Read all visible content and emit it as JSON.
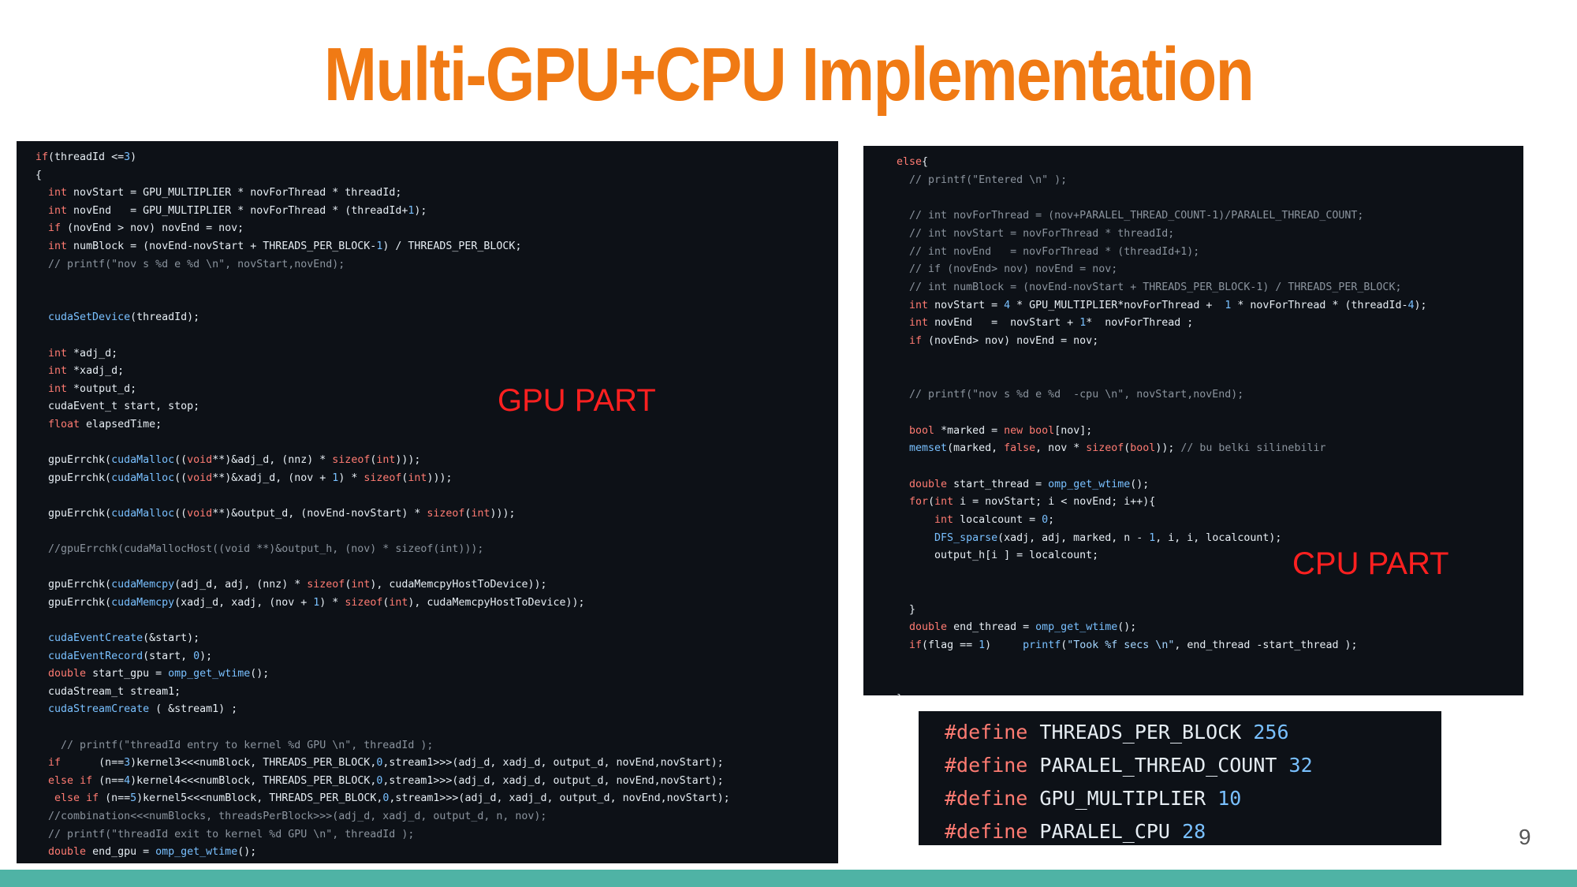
{
  "slide": {
    "title": "Multi-GPU+CPU Implementation",
    "page_number": "9"
  },
  "labels": {
    "gpu_part": "GPU PART",
    "cpu_part": "CPU PART"
  },
  "colors": {
    "title": "#f07a14",
    "label": "#ff2020",
    "code_background": "#0d1117",
    "keyword": "#ff7b72",
    "function": "#79c0ff",
    "comment": "#8b949e",
    "bottom_bar": "#4fb3a5"
  },
  "gpu_code": [
    "if(threadId <=3)",
    "{",
    "  int novStart = GPU_MULTIPLIER * novForThread * threadId;",
    "  int novEnd   = GPU_MULTIPLIER * novForThread * (threadId+1);",
    "  if (novEnd > nov) novEnd = nov;",
    "  int numBlock = (novEnd-novStart + THREADS_PER_BLOCK-1) / THREADS_PER_BLOCK;",
    "  // printf(\"nov s %d e %d \\n\", novStart,novEnd);",
    "",
    "",
    "  cudaSetDevice(threadId);",
    "",
    "  int *adj_d;",
    "  int *xadj_d;",
    "  int *output_d;",
    "  cudaEvent_t start, stop;",
    "  float elapsedTime;",
    "",
    "  gpuErrchk(cudaMalloc((void**)&adj_d, (nnz) * sizeof(int)));",
    "  gpuErrchk(cudaMalloc((void**)&xadj_d, (nov + 1) * sizeof(int)));",
    "",
    "  gpuErrchk(cudaMalloc((void**)&output_d, (novEnd-novStart) * sizeof(int)));",
    "",
    "  //gpuErrchk(cudaMallocHost((void **)&output_h, (nov) * sizeof(int)));",
    "",
    "  gpuErrchk(cudaMemcpy(adj_d, adj, (nnz) * sizeof(int), cudaMemcpyHostToDevice));",
    "  gpuErrchk(cudaMemcpy(xadj_d, xadj, (nov + 1) * sizeof(int), cudaMemcpyHostToDevice));",
    "",
    "  cudaEventCreate(&start);",
    "  cudaEventRecord(start, 0);",
    "  double start_gpu = omp_get_wtime();",
    "  cudaStream_t stream1;",
    "  cudaStreamCreate ( &stream1) ;",
    "",
    "    // printf(\"threadId entry to kernel %d GPU \\n\", threadId );",
    "  if      (n==3)kernel3<<<numBlock, THREADS_PER_BLOCK,0,stream1>>>(adj_d, xadj_d, output_d, novEnd,novStart);",
    "  else if (n==4)kernel4<<<numBlock, THREADS_PER_BLOCK,0,stream1>>>(adj_d, xadj_d, output_d, novEnd,novStart);",
    "   else if (n==5)kernel5<<<numBlock, THREADS_PER_BLOCK,0,stream1>>>(adj_d, xadj_d, output_d, novEnd,novStart);",
    "  //combination<<<numBlocks, threadsPerBlock>>>(adj_d, xadj_d, output_d, n, nov);",
    "  // printf(\"threadId exit to kernel %d GPU \\n\", threadId );",
    "  double end_gpu = omp_get_wtime();"
  ],
  "cpu_code": [
    "  else{",
    "    // printf(\"Entered \\n\" );",
    "",
    "    // int novForThread = (nov+PARALEL_THREAD_COUNT-1)/PARALEL_THREAD_COUNT;",
    "    // int novStart = novForThread * threadId;",
    "    // int novEnd   = novForThread * (threadId+1);",
    "    // if (novEnd> nov) novEnd = nov;",
    "    // int numBlock = (novEnd-novStart + THREADS_PER_BLOCK-1) / THREADS_PER_BLOCK;",
    "    int novStart = 4 * GPU_MULTIPLIER*novForThread +  1 * novForThread * (threadId-4);",
    "    int novEnd   =  novStart + 1*  novForThread ;",
    "    if (novEnd> nov) novEnd = nov;",
    "",
    "",
    "    // printf(\"nov s %d e %d  -cpu \\n\", novStart,novEnd);",
    "",
    "    bool *marked = new bool[nov];",
    "    memset(marked, false, nov * sizeof(bool)); // bu belki silinebilir",
    "",
    "    double start_thread = omp_get_wtime();",
    "    for(int i = novStart; i < novEnd; i++){",
    "        int localcount = 0;",
    "        DFS_sparse(xadj, adj, marked, n - 1, i, i, localcount);",
    "        output_h[i ] = localcount;",
    "",
    "",
    "    }",
    "    double end_thread = omp_get_wtime();",
    "    if(flag == 1)     printf(\"Took %f secs \\n\", end_thread -start_thread );",
    "",
    "",
    "  }"
  ],
  "defines": [
    {
      "keyword": "#define",
      "name": "THREADS_PER_BLOCK",
      "value": "256"
    },
    {
      "keyword": "#define",
      "name": "PARALEL_THREAD_COUNT",
      "value": "32"
    },
    {
      "keyword": "#define",
      "name": "GPU_MULTIPLIER",
      "value": "10"
    },
    {
      "keyword": "#define",
      "name": "PARALEL_CPU",
      "value": "28"
    }
  ]
}
